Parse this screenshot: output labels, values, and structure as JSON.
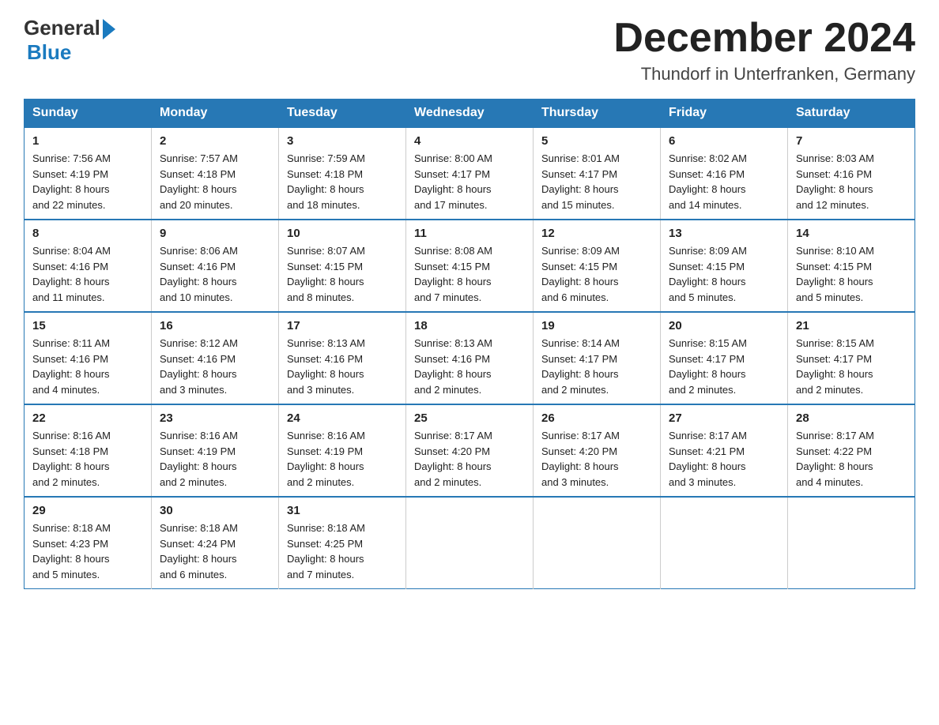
{
  "header": {
    "logo": {
      "general": "General",
      "blue": "Blue"
    },
    "title": "December 2024",
    "subtitle": "Thundorf in Unterfranken, Germany"
  },
  "weekdays": [
    "Sunday",
    "Monday",
    "Tuesday",
    "Wednesday",
    "Thursday",
    "Friday",
    "Saturday"
  ],
  "weeks": [
    [
      {
        "day": "1",
        "sunrise": "Sunrise: 7:56 AM",
        "sunset": "Sunset: 4:19 PM",
        "daylight": "Daylight: 8 hours",
        "minutes": "and 22 minutes."
      },
      {
        "day": "2",
        "sunrise": "Sunrise: 7:57 AM",
        "sunset": "Sunset: 4:18 PM",
        "daylight": "Daylight: 8 hours",
        "minutes": "and 20 minutes."
      },
      {
        "day": "3",
        "sunrise": "Sunrise: 7:59 AM",
        "sunset": "Sunset: 4:18 PM",
        "daylight": "Daylight: 8 hours",
        "minutes": "and 18 minutes."
      },
      {
        "day": "4",
        "sunrise": "Sunrise: 8:00 AM",
        "sunset": "Sunset: 4:17 PM",
        "daylight": "Daylight: 8 hours",
        "minutes": "and 17 minutes."
      },
      {
        "day": "5",
        "sunrise": "Sunrise: 8:01 AM",
        "sunset": "Sunset: 4:17 PM",
        "daylight": "Daylight: 8 hours",
        "minutes": "and 15 minutes."
      },
      {
        "day": "6",
        "sunrise": "Sunrise: 8:02 AM",
        "sunset": "Sunset: 4:16 PM",
        "daylight": "Daylight: 8 hours",
        "minutes": "and 14 minutes."
      },
      {
        "day": "7",
        "sunrise": "Sunrise: 8:03 AM",
        "sunset": "Sunset: 4:16 PM",
        "daylight": "Daylight: 8 hours",
        "minutes": "and 12 minutes."
      }
    ],
    [
      {
        "day": "8",
        "sunrise": "Sunrise: 8:04 AM",
        "sunset": "Sunset: 4:16 PM",
        "daylight": "Daylight: 8 hours",
        "minutes": "and 11 minutes."
      },
      {
        "day": "9",
        "sunrise": "Sunrise: 8:06 AM",
        "sunset": "Sunset: 4:16 PM",
        "daylight": "Daylight: 8 hours",
        "minutes": "and 10 minutes."
      },
      {
        "day": "10",
        "sunrise": "Sunrise: 8:07 AM",
        "sunset": "Sunset: 4:15 PM",
        "daylight": "Daylight: 8 hours",
        "minutes": "and 8 minutes."
      },
      {
        "day": "11",
        "sunrise": "Sunrise: 8:08 AM",
        "sunset": "Sunset: 4:15 PM",
        "daylight": "Daylight: 8 hours",
        "minutes": "and 7 minutes."
      },
      {
        "day": "12",
        "sunrise": "Sunrise: 8:09 AM",
        "sunset": "Sunset: 4:15 PM",
        "daylight": "Daylight: 8 hours",
        "minutes": "and 6 minutes."
      },
      {
        "day": "13",
        "sunrise": "Sunrise: 8:09 AM",
        "sunset": "Sunset: 4:15 PM",
        "daylight": "Daylight: 8 hours",
        "minutes": "and 5 minutes."
      },
      {
        "day": "14",
        "sunrise": "Sunrise: 8:10 AM",
        "sunset": "Sunset: 4:15 PM",
        "daylight": "Daylight: 8 hours",
        "minutes": "and 5 minutes."
      }
    ],
    [
      {
        "day": "15",
        "sunrise": "Sunrise: 8:11 AM",
        "sunset": "Sunset: 4:16 PM",
        "daylight": "Daylight: 8 hours",
        "minutes": "and 4 minutes."
      },
      {
        "day": "16",
        "sunrise": "Sunrise: 8:12 AM",
        "sunset": "Sunset: 4:16 PM",
        "daylight": "Daylight: 8 hours",
        "minutes": "and 3 minutes."
      },
      {
        "day": "17",
        "sunrise": "Sunrise: 8:13 AM",
        "sunset": "Sunset: 4:16 PM",
        "daylight": "Daylight: 8 hours",
        "minutes": "and 3 minutes."
      },
      {
        "day": "18",
        "sunrise": "Sunrise: 8:13 AM",
        "sunset": "Sunset: 4:16 PM",
        "daylight": "Daylight: 8 hours",
        "minutes": "and 2 minutes."
      },
      {
        "day": "19",
        "sunrise": "Sunrise: 8:14 AM",
        "sunset": "Sunset: 4:17 PM",
        "daylight": "Daylight: 8 hours",
        "minutes": "and 2 minutes."
      },
      {
        "day": "20",
        "sunrise": "Sunrise: 8:15 AM",
        "sunset": "Sunset: 4:17 PM",
        "daylight": "Daylight: 8 hours",
        "minutes": "and 2 minutes."
      },
      {
        "day": "21",
        "sunrise": "Sunrise: 8:15 AM",
        "sunset": "Sunset: 4:17 PM",
        "daylight": "Daylight: 8 hours",
        "minutes": "and 2 minutes."
      }
    ],
    [
      {
        "day": "22",
        "sunrise": "Sunrise: 8:16 AM",
        "sunset": "Sunset: 4:18 PM",
        "daylight": "Daylight: 8 hours",
        "minutes": "and 2 minutes."
      },
      {
        "day": "23",
        "sunrise": "Sunrise: 8:16 AM",
        "sunset": "Sunset: 4:19 PM",
        "daylight": "Daylight: 8 hours",
        "minutes": "and 2 minutes."
      },
      {
        "day": "24",
        "sunrise": "Sunrise: 8:16 AM",
        "sunset": "Sunset: 4:19 PM",
        "daylight": "Daylight: 8 hours",
        "minutes": "and 2 minutes."
      },
      {
        "day": "25",
        "sunrise": "Sunrise: 8:17 AM",
        "sunset": "Sunset: 4:20 PM",
        "daylight": "Daylight: 8 hours",
        "minutes": "and 2 minutes."
      },
      {
        "day": "26",
        "sunrise": "Sunrise: 8:17 AM",
        "sunset": "Sunset: 4:20 PM",
        "daylight": "Daylight: 8 hours",
        "minutes": "and 3 minutes."
      },
      {
        "day": "27",
        "sunrise": "Sunrise: 8:17 AM",
        "sunset": "Sunset: 4:21 PM",
        "daylight": "Daylight: 8 hours",
        "minutes": "and 3 minutes."
      },
      {
        "day": "28",
        "sunrise": "Sunrise: 8:17 AM",
        "sunset": "Sunset: 4:22 PM",
        "daylight": "Daylight: 8 hours",
        "minutes": "and 4 minutes."
      }
    ],
    [
      {
        "day": "29",
        "sunrise": "Sunrise: 8:18 AM",
        "sunset": "Sunset: 4:23 PM",
        "daylight": "Daylight: 8 hours",
        "minutes": "and 5 minutes."
      },
      {
        "day": "30",
        "sunrise": "Sunrise: 8:18 AM",
        "sunset": "Sunset: 4:24 PM",
        "daylight": "Daylight: 8 hours",
        "minutes": "and 6 minutes."
      },
      {
        "day": "31",
        "sunrise": "Sunrise: 8:18 AM",
        "sunset": "Sunset: 4:25 PM",
        "daylight": "Daylight: 8 hours",
        "minutes": "and 7 minutes."
      },
      null,
      null,
      null,
      null
    ]
  ]
}
